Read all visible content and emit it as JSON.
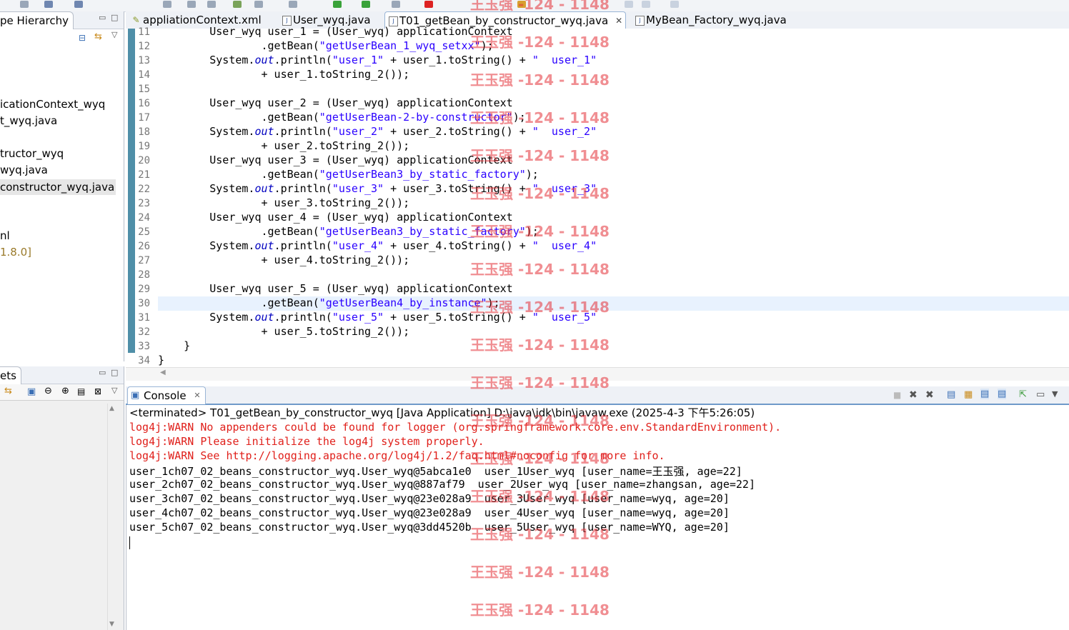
{
  "left_top_panel": {
    "tab_label": "pe Hierarchy",
    "tree_items": [
      "icationContext_wyq",
      "t_wyq.java",
      "tructor_wyq",
      "wyq.java",
      "constructor_wyq.java",
      "nl",
      "1.8.0]"
    ]
  },
  "left_bottom_panel": {
    "tab_label": "ets"
  },
  "editor": {
    "tabs": [
      {
        "label": "appliationContext.xml"
      },
      {
        "label": "User_wyq.java"
      },
      {
        "label": "T01_getBean_by_constructor_wyq.java",
        "active": true
      },
      {
        "label": "MyBean_Factory_wyq.java"
      }
    ],
    "lines": [
      {
        "num": "11",
        "segments": [
          {
            "t": "        User_wyq user_1 = (User_wyq) applicationContext"
          }
        ]
      },
      {
        "num": "12",
        "segments": [
          {
            "t": "                .getBean("
          },
          {
            "t": "\"getUserBean_1_wyq_setxx\"",
            "c": "str"
          },
          {
            "t": ");"
          }
        ]
      },
      {
        "num": "13",
        "segments": [
          {
            "t": "        System."
          },
          {
            "t": "out",
            "c": "fld"
          },
          {
            "t": ".println("
          },
          {
            "t": "\"user_1\"",
            "c": "str"
          },
          {
            "t": " + user_1.toString() + "
          },
          {
            "t": "\"  user_1\"",
            "c": "str"
          }
        ]
      },
      {
        "num": "14",
        "segments": [
          {
            "t": "                + user_1.toString_2());"
          }
        ]
      },
      {
        "num": "15",
        "segments": [
          {
            "t": ""
          }
        ]
      },
      {
        "num": "16",
        "segments": [
          {
            "t": "        User_wyq user_2 = (User_wyq) applicationContext"
          }
        ]
      },
      {
        "num": "17",
        "segments": [
          {
            "t": "                .getBean("
          },
          {
            "t": "\"getUserBean-2-by-constructor\"",
            "c": "str"
          },
          {
            "t": ");"
          }
        ]
      },
      {
        "num": "18",
        "segments": [
          {
            "t": "        System."
          },
          {
            "t": "out",
            "c": "fld"
          },
          {
            "t": ".println("
          },
          {
            "t": "\"user_2\"",
            "c": "str"
          },
          {
            "t": " + user_2.toString() + "
          },
          {
            "t": "\"  user_2\"",
            "c": "str"
          }
        ]
      },
      {
        "num": "19",
        "segments": [
          {
            "t": "                + user_2.toString_2());"
          }
        ]
      },
      {
        "num": "20",
        "segments": [
          {
            "t": "        User_wyq user_3 = (User_wyq) applicationContext"
          }
        ]
      },
      {
        "num": "21",
        "segments": [
          {
            "t": "                .getBean("
          },
          {
            "t": "\"getUserBean3_by_static_factory\"",
            "c": "str"
          },
          {
            "t": ");"
          }
        ]
      },
      {
        "num": "22",
        "segments": [
          {
            "t": "        System."
          },
          {
            "t": "out",
            "c": "fld"
          },
          {
            "t": ".println("
          },
          {
            "t": "\"user_3\"",
            "c": "str"
          },
          {
            "t": " + user_3.toString() + "
          },
          {
            "t": "\"  user_3\"",
            "c": "str"
          }
        ]
      },
      {
        "num": "23",
        "segments": [
          {
            "t": "                + user_3.toString_2());"
          }
        ]
      },
      {
        "num": "24",
        "segments": [
          {
            "t": "        User_wyq user_4 = (User_wyq) applicationContext"
          }
        ]
      },
      {
        "num": "25",
        "segments": [
          {
            "t": "                .getBean("
          },
          {
            "t": "\"getUserBean3_by_static_factory\"",
            "c": "str"
          },
          {
            "t": ");"
          }
        ]
      },
      {
        "num": "26",
        "segments": [
          {
            "t": "        System."
          },
          {
            "t": "out",
            "c": "fld"
          },
          {
            "t": ".println("
          },
          {
            "t": "\"user_4\"",
            "c": "str"
          },
          {
            "t": " + user_4.toString() + "
          },
          {
            "t": "\"  user_4\"",
            "c": "str"
          }
        ]
      },
      {
        "num": "27",
        "segments": [
          {
            "t": "                + user_4.toString_2());"
          }
        ]
      },
      {
        "num": "28",
        "segments": [
          {
            "t": ""
          }
        ]
      },
      {
        "num": "29",
        "segments": [
          {
            "t": "        User_wyq user_5 = (User_wyq) applicationContext"
          }
        ]
      },
      {
        "num": "30",
        "segments": [
          {
            "t": "                .getBean("
          },
          {
            "t": "\"getUserBean4_by_instance\"",
            "c": "str"
          },
          {
            "t": ");"
          }
        ]
      },
      {
        "num": "31",
        "segments": [
          {
            "t": "        System."
          },
          {
            "t": "out",
            "c": "fld"
          },
          {
            "t": ".println("
          },
          {
            "t": "\"user_5\"",
            "c": "str"
          },
          {
            "t": " + user_5.toString() + "
          },
          {
            "t": "\"  user_5\"",
            "c": "str"
          }
        ]
      },
      {
        "num": "32",
        "segments": [
          {
            "t": "                + user_5.toString_2());"
          }
        ]
      },
      {
        "num": "33",
        "segments": [
          {
            "t": "    }"
          }
        ]
      },
      {
        "num": "34",
        "segments": [
          {
            "t": "}"
          }
        ]
      }
    ]
  },
  "console": {
    "tab_label": "Console",
    "status": "<terminated> T01_getBean_by_constructor_wyq [Java Application] D:\\java\\jdk\\bin\\javaw.exe (2025-4-3 下午5:26:05)",
    "lines": [
      {
        "text": "log4j:WARN No appenders could be found for logger (org.springframework.core.env.StandardEnvironment).",
        "kind": "warn"
      },
      {
        "text": "log4j:WARN Please initialize the log4j system properly.",
        "kind": "warn"
      },
      {
        "text": "log4j:WARN See http://logging.apache.org/log4j/1.2/faq.html#noconfig for more info.",
        "kind": "warn"
      },
      {
        "text": "user_1ch07_02_beans_constructor_wyq.User_wyq@5abca1e0  user_1User_wyq [user_name=王玉强, age=22]",
        "kind": "out"
      },
      {
        "text": "user_2ch07_02_beans_constructor_wyq.User_wyq@887af79  user_2User_wyq [user_name=zhangsan, age=22]",
        "kind": "out"
      },
      {
        "text": "user_3ch07_02_beans_constructor_wyq.User_wyq@23e028a9  user_3User_wyq [user_name=wyq, age=20]",
        "kind": "out"
      },
      {
        "text": "user_4ch07_02_beans_constructor_wyq.User_wyq@23e028a9  user_4User_wyq [user_name=wyq, age=20]",
        "kind": "out"
      },
      {
        "text": "user_5ch07_02_beans_constructor_wyq.User_wyq@3dd4520b  user_5User_wyq [user_name=WYQ, age=20]",
        "kind": "out"
      }
    ]
  },
  "watermark": {
    "text": "王玉强 -124 - 1148"
  },
  "colors": {
    "string": "#2a00ff",
    "field": "#0000c0",
    "warn": "#e0201b",
    "watermark": "#e5333a",
    "gutter": "#4f8fa8"
  }
}
